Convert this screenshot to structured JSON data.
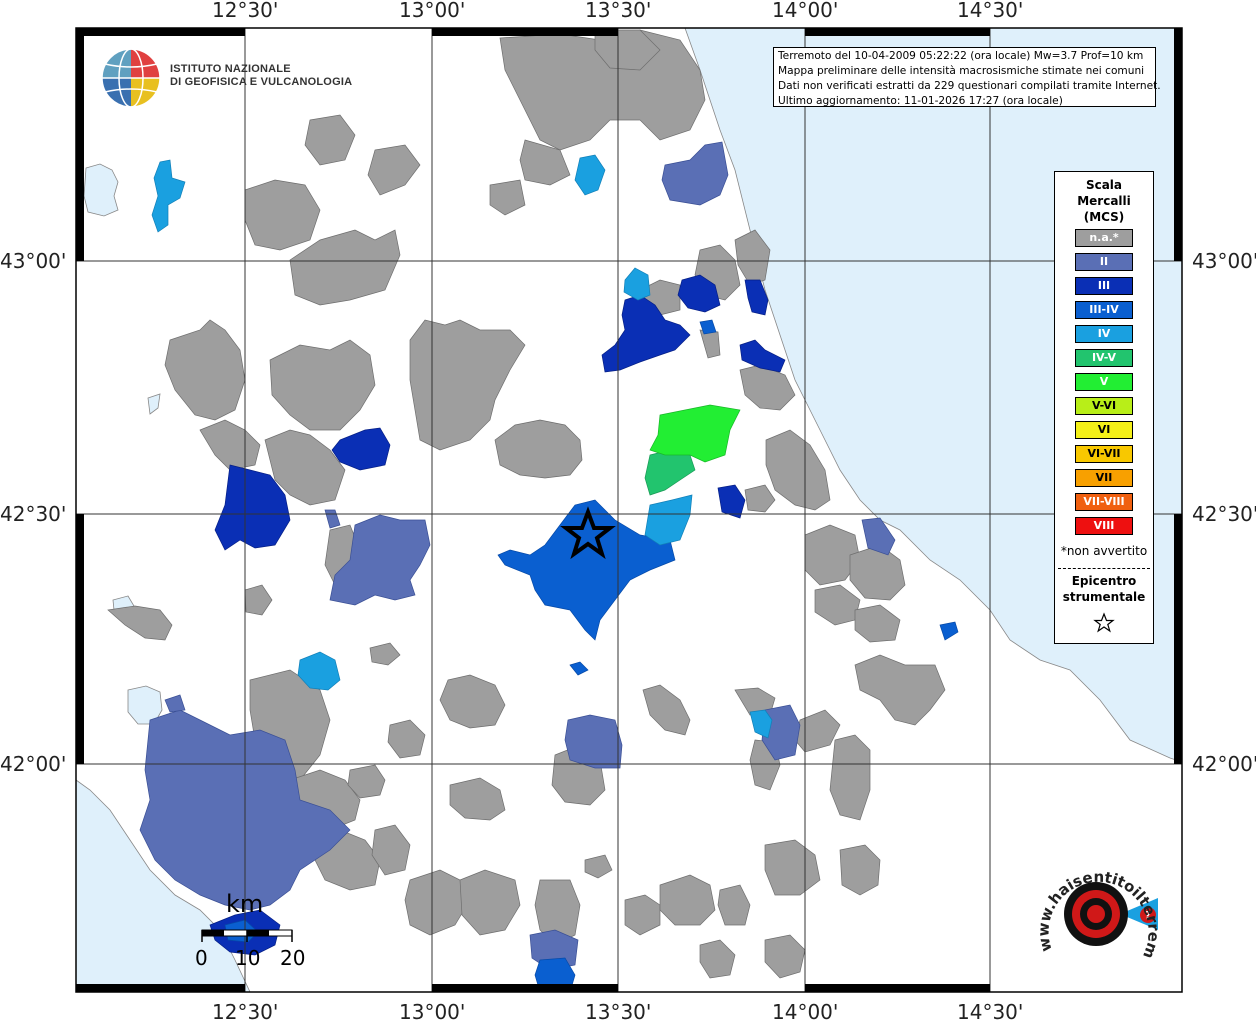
{
  "map": {
    "top_labels": [
      "12°30'",
      "13°00'",
      "13°30'",
      "14°00'",
      "14°30'"
    ],
    "bottom_labels": [
      "12°30'",
      "13°00'",
      "13°30'",
      "14°00'",
      "14°30'"
    ],
    "left_labels": [
      "43°00'",
      "42°30'",
      "42°00'"
    ],
    "right_labels": [
      "43°00'",
      "42°30'",
      "42°00'"
    ],
    "colors": {
      "sea": "#dff0fb",
      "land": "#ffffff",
      "na": "#9e9e9e",
      "II": "#5a6fb5",
      "III": "#0a2fb5",
      "III_IV": "#0a5fd0",
      "IV": "#1aa0e0",
      "IV_V": "#22c46e",
      "V": "#22ee33"
    }
  },
  "logo": {
    "line1": "ISTITUTO NAZIONALE",
    "line2": "DI GEOFISICA E VULCANOLOGIA",
    "icon": "globe-icon"
  },
  "info": {
    "line1": "Terremoto del 10-04-2009 05:22:22 (ora locale) Mw=3.7 Prof=10 km",
    "line2": "Mappa preliminare delle intensità macrosismiche stimate nei comuni",
    "line3": "Dati non verificati estratti da 229 questionari compilati tramite Internet.",
    "line4": "Ultimo aggiornamento: 11-01-2026 17:27 (ora locale)"
  },
  "legend": {
    "title1": "Scala",
    "title2": "Mercalli",
    "title3": "(MCS)",
    "items": [
      {
        "label": "n.a.*",
        "color": "#9e9e9e"
      },
      {
        "label": "II",
        "color": "#5a6fb5"
      },
      {
        "label": "III",
        "color": "#0a2fb5"
      },
      {
        "label": "III-IV",
        "color": "#0a5fd0"
      },
      {
        "label": "IV",
        "color": "#1aa0e0"
      },
      {
        "label": "IV-V",
        "color": "#22c46e"
      },
      {
        "label": "V",
        "color": "#22ee33"
      },
      {
        "label": "V-VI",
        "color": "#b8ee18"
      },
      {
        "label": "VI",
        "color": "#f4f018"
      },
      {
        "label": "VI-VII",
        "color": "#f8c800"
      },
      {
        "label": "VII",
        "color": "#f8a000"
      },
      {
        "label": "VII-VIII",
        "color": "#f06010"
      },
      {
        "label": "VIII",
        "color": "#ee1010"
      }
    ],
    "note": "*non avvertito",
    "epi1": "Epicentro",
    "epi2": "strumentale",
    "epi_icon": "star-icon"
  },
  "scale": {
    "unit": "km",
    "ticks": [
      "0",
      "10",
      "20"
    ]
  },
  "badge": {
    "text": "www.haisentitoilterremoto.it",
    "icon": "seismometer-icon"
  }
}
